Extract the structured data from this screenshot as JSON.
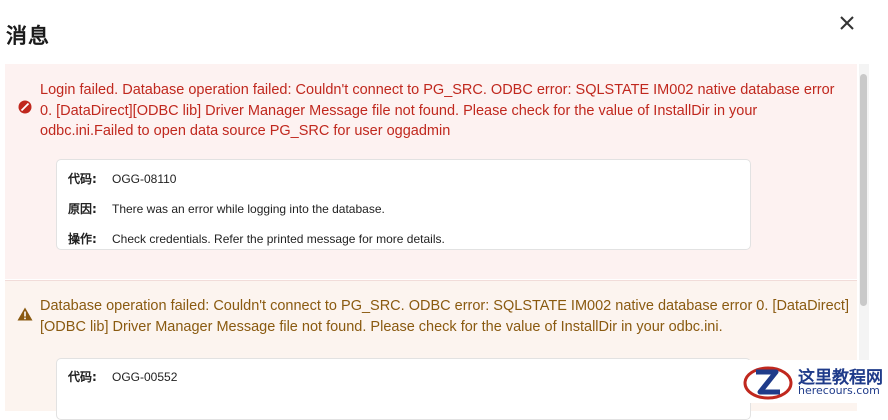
{
  "dialog": {
    "title": "消息"
  },
  "messages": [
    {
      "type": "error",
      "text": "Login failed. Database operation failed: Couldn't connect to PG_SRC. ODBC error: SQLSTATE IM002 native database error 0. [DataDirect][ODBC lib] Driver Manager Message file not found. Please check for the value of InstallDir in your odbc.ini.Failed to open data source PG_SRC for user oggadmin",
      "details": [
        {
          "key": "代码:",
          "value": "OGG-08110"
        },
        {
          "key": "原因:",
          "value": "There was an error while logging into the database."
        },
        {
          "key": "操作:",
          "value": "Check credentials. Refer the printed message for more details."
        }
      ]
    },
    {
      "type": "warning",
      "text": "Database operation failed: Couldn't connect to PG_SRC. ODBC error: SQLSTATE IM002 native database error 0. [DataDirect][ODBC lib] Driver Manager Message file not found. Please check for the value of InstallDir in your odbc.ini.",
      "details": [
        {
          "key": "代码:",
          "value": "OGG-00552"
        }
      ]
    }
  ],
  "watermark": {
    "main": "这里教程网",
    "sub": "herecours.com"
  },
  "colors": {
    "error": "#c0281e",
    "warning": "#8a5a10",
    "panel": "#fdf2f1"
  }
}
